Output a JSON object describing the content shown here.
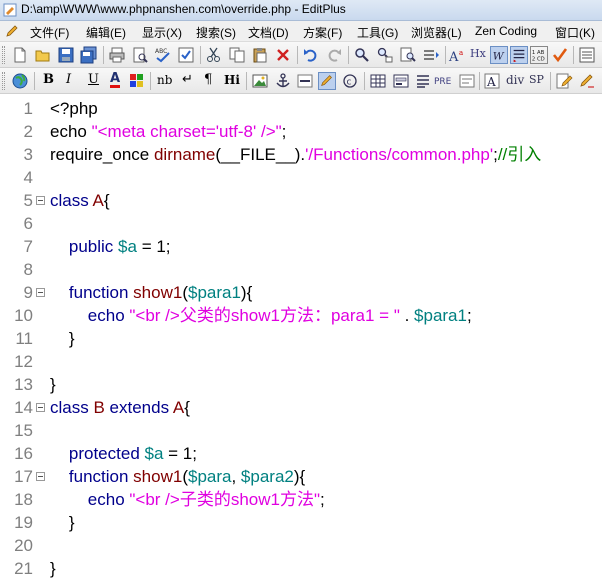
{
  "window": {
    "title": "D:\\amp\\WWW\\www.phpnanshen.com\\override.php - EditPlus"
  },
  "menu": [
    {
      "label": "文件(F)"
    },
    {
      "label": "编辑(E)"
    },
    {
      "label": "显示(X)"
    },
    {
      "label": "搜索(S)"
    },
    {
      "label": "文档(D)"
    },
    {
      "label": "方案(F)"
    },
    {
      "label": "工具(G)"
    },
    {
      "label": "浏览器(L)"
    },
    {
      "label": "Zen Coding"
    },
    {
      "label": "窗口(K)"
    }
  ],
  "toolbar2_text": {
    "bold": "B",
    "italic": "I",
    "underline": "U",
    "font_color": "A",
    "nbsp": "nb",
    "break": "↵",
    "paragraph": "¶",
    "heading": "Hi",
    "pre": "PRE",
    "div": "div",
    "span": "SP"
  },
  "toolbar1_text": {
    "hx": "Hx"
  },
  "editor": {
    "lines": [
      {
        "n": "1",
        "fold": false,
        "tokens": [
          {
            "c": "t-black",
            "t": "<?php"
          }
        ]
      },
      {
        "n": "2",
        "fold": false,
        "tokens": [
          {
            "c": "t-black",
            "t": "echo "
          },
          {
            "c": "t-str",
            "t": "\"<meta charset='utf-8' />\""
          },
          {
            "c": "t-black",
            "t": ";"
          }
        ]
      },
      {
        "n": "3",
        "fold": false,
        "tokens": [
          {
            "c": "t-black",
            "t": "require_once "
          },
          {
            "c": "t-fn",
            "t": "dirname"
          },
          {
            "c": "t-black",
            "t": "(__FILE__)."
          },
          {
            "c": "t-str",
            "t": "'/Functions/common.php'"
          },
          {
            "c": "t-black",
            "t": ";"
          },
          {
            "c": "t-cmt",
            "t": "//引入"
          }
        ]
      },
      {
        "n": "4",
        "fold": false,
        "tokens": []
      },
      {
        "n": "5",
        "fold": true,
        "tokens": [
          {
            "c": "t-kw",
            "t": "class "
          },
          {
            "c": "t-fn",
            "t": "A"
          },
          {
            "c": "t-black",
            "t": "{"
          }
        ]
      },
      {
        "n": "6",
        "fold": false,
        "tokens": []
      },
      {
        "n": "7",
        "fold": false,
        "tokens": [
          {
            "c": "t-kw",
            "t": "    public "
          },
          {
            "c": "t-var",
            "t": "$a"
          },
          {
            "c": "t-black",
            "t": " = 1;"
          }
        ]
      },
      {
        "n": "8",
        "fold": false,
        "tokens": []
      },
      {
        "n": "9",
        "fold": true,
        "tokens": [
          {
            "c": "t-kw",
            "t": "    function "
          },
          {
            "c": "t-fn",
            "t": "show1"
          },
          {
            "c": "t-black",
            "t": "("
          },
          {
            "c": "t-var",
            "t": "$para1"
          },
          {
            "c": "t-black",
            "t": "){"
          }
        ]
      },
      {
        "n": "10",
        "fold": false,
        "tokens": [
          {
            "c": "t-kw",
            "t": "        echo "
          },
          {
            "c": "t-str",
            "t": "\"<br />父类的show1方法：para1 = \""
          },
          {
            "c": "t-black",
            "t": " . "
          },
          {
            "c": "t-var",
            "t": "$para1"
          },
          {
            "c": "t-black",
            "t": ";"
          }
        ]
      },
      {
        "n": "11",
        "fold": false,
        "tokens": [
          {
            "c": "t-black",
            "t": "    }"
          }
        ]
      },
      {
        "n": "12",
        "fold": false,
        "tokens": []
      },
      {
        "n": "13",
        "fold": false,
        "tokens": [
          {
            "c": "t-black",
            "t": "}"
          }
        ]
      },
      {
        "n": "14",
        "fold": true,
        "tokens": [
          {
            "c": "t-kw",
            "t": "class "
          },
          {
            "c": "t-fn",
            "t": "B"
          },
          {
            "c": "t-kw",
            "t": " extends "
          },
          {
            "c": "t-fn",
            "t": "A"
          },
          {
            "c": "t-black",
            "t": "{"
          }
        ]
      },
      {
        "n": "15",
        "fold": false,
        "tokens": []
      },
      {
        "n": "16",
        "fold": false,
        "tokens": [
          {
            "c": "t-kw",
            "t": "    protected "
          },
          {
            "c": "t-var",
            "t": "$a"
          },
          {
            "c": "t-black",
            "t": " = 1;"
          }
        ]
      },
      {
        "n": "17",
        "fold": true,
        "tokens": [
          {
            "c": "t-kw",
            "t": "    function "
          },
          {
            "c": "t-fn",
            "t": "show1"
          },
          {
            "c": "t-black",
            "t": "("
          },
          {
            "c": "t-var",
            "t": "$para"
          },
          {
            "c": "t-black",
            "t": ", "
          },
          {
            "c": "t-var",
            "t": "$para2"
          },
          {
            "c": "t-black",
            "t": "){"
          }
        ]
      },
      {
        "n": "18",
        "fold": false,
        "tokens": [
          {
            "c": "t-kw",
            "t": "        echo "
          },
          {
            "c": "t-str",
            "t": "\"<br />子类的show1方法\""
          },
          {
            "c": "t-black",
            "t": ";"
          }
        ]
      },
      {
        "n": "19",
        "fold": false,
        "tokens": [
          {
            "c": "t-black",
            "t": "    }"
          }
        ]
      },
      {
        "n": "20",
        "fold": false,
        "tokens": []
      },
      {
        "n": "21",
        "fold": false,
        "tokens": [
          {
            "c": "t-black",
            "t": "}"
          }
        ]
      }
    ]
  }
}
